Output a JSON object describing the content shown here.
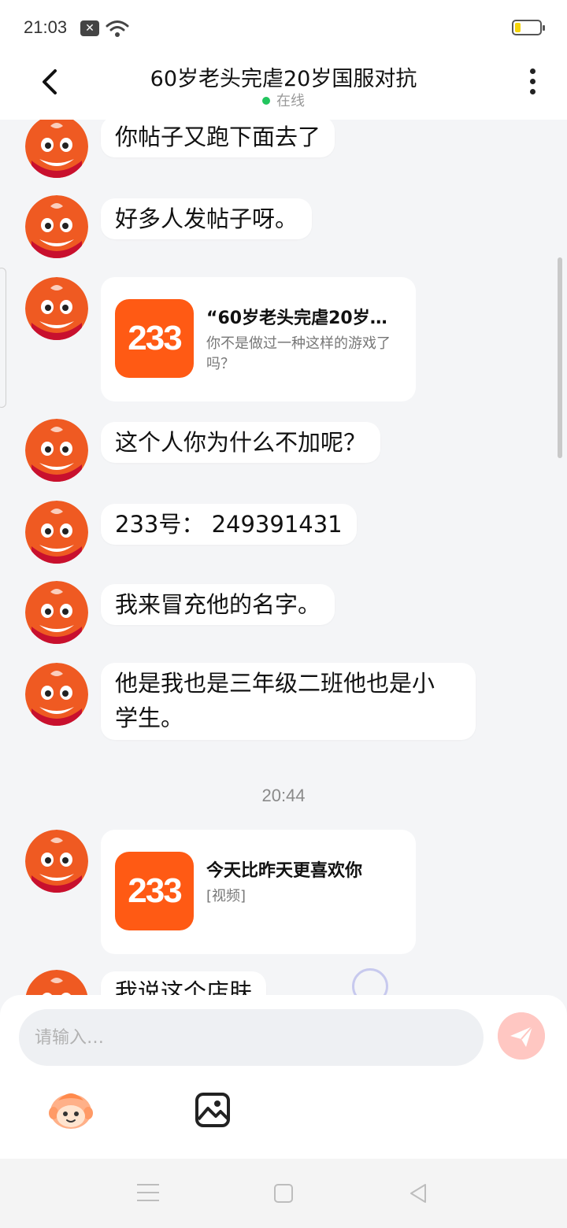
{
  "status_bar": {
    "time": "21:03"
  },
  "header": {
    "title": "60岁老头完虐20岁国服对抗",
    "status": "在线"
  },
  "messages": [
    {
      "type": "text",
      "text": "你帖子又跑下面去了"
    },
    {
      "type": "text",
      "text": "好多人发帖子呀。"
    },
    {
      "type": "card",
      "logo": "233",
      "title": "“60岁老头完虐20岁…",
      "desc": "你不是做过一种这样的游戏了吗？"
    },
    {
      "type": "text",
      "text": "这个人你为什么不加呢？"
    },
    {
      "type": "text",
      "text": "233号： 249391431"
    },
    {
      "type": "text",
      "text": "我来冒充他的名字。"
    },
    {
      "type": "text",
      "line1": "他是我也是三年级二班他也是小",
      "line2": "学生。"
    },
    {
      "type": "time",
      "text": "20:44"
    },
    {
      "type": "card",
      "logo": "233",
      "title": "今天比昨天更喜欢你",
      "desc": "[视频]"
    },
    {
      "type": "text",
      "text": "我说这个店肤"
    }
  ],
  "input": {
    "placeholder": "请输入…"
  },
  "icons": {
    "back": "back-arrow-icon",
    "more": "more-vertical-icon",
    "send": "send-icon",
    "emoji": "emoji-avatar-icon",
    "image": "image-icon"
  },
  "colors": {
    "accent": "#ff5a14",
    "online": "#22c55e",
    "send_disabled": "#ffc7c2"
  }
}
